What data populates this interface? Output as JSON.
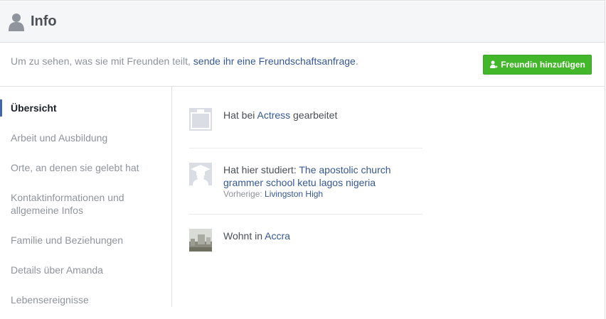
{
  "header": {
    "title": "Info",
    "icon": "person-icon"
  },
  "notice": {
    "prefix": "Um zu sehen, was sie mit Freunden teilt, ",
    "link": "sende ihr eine Freundschaftsanfrage",
    "suffix": "."
  },
  "add_friend_button": {
    "label": "Freundin hinzufügen",
    "icon": "add-friend-icon",
    "color": "#42b72a"
  },
  "sidebar": {
    "items": [
      {
        "label": "Übersicht",
        "active": true
      },
      {
        "label": "Arbeit und Ausbildung"
      },
      {
        "label": "Orte, an denen sie gelebt hat"
      },
      {
        "label": "Kontaktinformationen und allgemeine Infos"
      },
      {
        "label": "Familie und Beziehungen"
      },
      {
        "label": "Details über Amanda"
      },
      {
        "label": "Lebensereignisse"
      }
    ]
  },
  "overview": {
    "work": {
      "prefix": "Hat bei ",
      "link": "Actress",
      "suffix": " gearbeitet",
      "icon": "briefcase-icon"
    },
    "education": {
      "prefix": "Hat hier studiert: ",
      "link": "The apostolic church grammer school ketu lagos nigeria",
      "previous_label": "Vorherige: ",
      "previous_link": "Livingston High",
      "icon": "graduation-cap-icon"
    },
    "residence": {
      "prefix": "Wohnt in ",
      "link": "Accra",
      "icon": "city-photo"
    }
  },
  "colors": {
    "link": "#365899",
    "accent": "#4267b2"
  }
}
